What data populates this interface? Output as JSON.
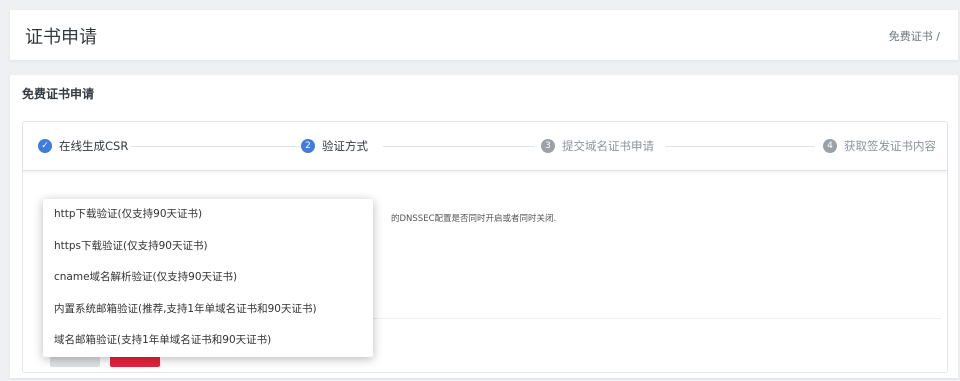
{
  "header": {
    "title": "证书申请",
    "breadcrumb": "免费证书 /"
  },
  "card": {
    "title": "免费证书申请"
  },
  "wizard": {
    "steps": [
      {
        "number": "✓",
        "label": "在线生成CSR",
        "state": "done"
      },
      {
        "number": "2",
        "label": "验证方式",
        "state": "active"
      },
      {
        "number": "3",
        "label": "提交域名证书申请",
        "state": "todo"
      },
      {
        "number": "4",
        "label": "获取签发证书内容",
        "state": "todo"
      }
    ],
    "hint_text": "的DNSSEC配置是否同时开启或者同时关闭.",
    "colors": {
      "accent": "#3e7ddb",
      "inactive": "#9ca1a6",
      "danger": "#e4243c"
    }
  },
  "dropdown": {
    "options": [
      "http下载验证(仅支持90天证书)",
      "https下载验证(仅支持90天证书)",
      "cname域名解析验证(仅支持90天证书)",
      "内置系统邮箱验证(推荐,支持1年单域名证书和90天证书)",
      "域名邮箱验证(支持1年单域名证书和90天证书)"
    ]
  }
}
